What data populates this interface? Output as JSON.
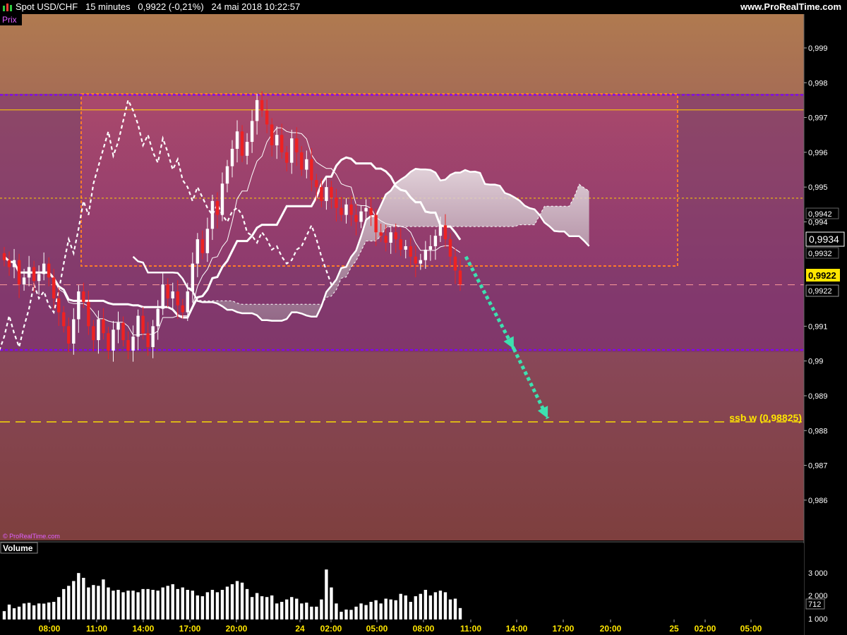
{
  "header": {
    "instrument": "Spot USD/CHF",
    "timeframe": "15 minutes",
    "quote": "0,9922 (-0,21%)",
    "datetime": "24 mai 2018 10:22:57",
    "site": "www.ProRealTime.com"
  },
  "price_panel": {
    "label": "Prix",
    "watermark": "© ProRealTime.com",
    "annotation": "ssb w (0,98825)",
    "badges": {
      "upper": "0,9942",
      "current_box": "0,9934",
      "lower": "0,9932",
      "last_yellow": "0,9922",
      "last_white": "0,9922"
    }
  },
  "volume_panel": {
    "label": "Volume",
    "axis_labels": [
      "3 000",
      "2 000",
      "1 000"
    ],
    "last_badge": "712"
  },
  "time_axis": {
    "labels": [
      "08:00",
      "11:00",
      "14:00",
      "17:00",
      "20:00",
      "24",
      "02:00",
      "05:00",
      "08:00",
      "11:00",
      "14:00",
      "17:00",
      "20:00",
      "25",
      "02:00",
      "05:00"
    ]
  },
  "colors": {
    "bull": "#ffffff",
    "bear": "#ee2222",
    "kijun": "#ffffff",
    "zone_border": "#ff7a2a",
    "level_line": "#7f00ff",
    "target_arrow": "#3de0b0",
    "accent_yellow": "#ffe600"
  },
  "chart_data": {
    "type": "candlestick",
    "y_axis_ticks": [
      "0,999",
      "0,998",
      "0,997",
      "0,996",
      "0,995",
      "0,994",
      "0,991",
      "0,99",
      "0,989",
      "0,988",
      "0,987",
      "0,986"
    ],
    "ylim": [
      0.9855,
      0.9998
    ],
    "levels": [
      {
        "name": "upper purple",
        "value": 0.99765
      },
      {
        "name": "lower purple",
        "value": 0.99032
      },
      {
        "name": "yellow solid",
        "value": 0.99722
      },
      {
        "name": "yellow dashed",
        "value": 0.99468
      },
      {
        "name": "ssb w",
        "value": 0.98825
      },
      {
        "name": "last price",
        "value": 0.99219
      }
    ],
    "zone": {
      "top": 0.99765,
      "bottom": 0.99283
    },
    "target_arrows": [
      {
        "from": 0.993,
        "to": 0.99035
      },
      {
        "from": 0.99035,
        "to": 0.98835
      }
    ],
    "price_path": [
      0.9929,
      0.9927,
      0.9929,
      0.9922,
      0.9924,
      0.9927,
      0.9923,
      0.9925,
      0.9928,
      0.9924,
      0.9918,
      0.9914,
      0.991,
      0.9905,
      0.9912,
      0.992,
      0.9917,
      0.991,
      0.9906,
      0.9912,
      0.9908,
      0.9903,
      0.9909,
      0.9911,
      0.9906,
      0.9903,
      0.9907,
      0.9913,
      0.9908,
      0.9904,
      0.991,
      0.9915,
      0.9922,
      0.9918,
      0.992,
      0.9916,
      0.9914,
      0.992,
      0.9928,
      0.9935,
      0.9931,
      0.9938,
      0.9946,
      0.9942,
      0.9951,
      0.9956,
      0.9961,
      0.9966,
      0.9959,
      0.9963,
      0.9969,
      0.9975,
      0.9972,
      0.9968,
      0.9962,
      0.9965,
      0.996,
      0.9957,
      0.9964,
      0.996,
      0.9955,
      0.9958,
      0.9952,
      0.995,
      0.9946,
      0.995,
      0.9947,
      0.9944,
      0.9942,
      0.9945,
      0.9942,
      0.994,
      0.9943,
      0.9944,
      0.9942,
      0.9937,
      0.9936,
      0.9934,
      0.9937,
      0.9935,
      0.9932,
      0.9933,
      0.993,
      0.9928,
      0.9929,
      0.9932,
      0.9933,
      0.9936,
      0.9939,
      0.9935,
      0.993,
      0.9926,
      0.9922
    ],
    "volumes": [
      520,
      930,
      700,
      800,
      1000,
      1040,
      880,
      1000,
      990,
      1060,
      1100,
      1400,
      1900,
      2100,
      2400,
      2900,
      2600,
      2000,
      2150,
      2100,
      2500,
      2000,
      1800,
      1850,
      1700,
      1800,
      1800,
      1700,
      1900,
      1900,
      1850,
      1800,
      2000,
      2100,
      2200,
      1900,
      2000,
      1850,
      1800,
      1500,
      1450,
      1700,
      1850,
      1700,
      1850,
      2050,
      2200,
      2400,
      2300,
      1900,
      1400,
      1650,
      1450,
      1400,
      1500,
      1000,
      1100,
      1250,
      1400,
      1300,
      1000,
      1050,
      800,
      800,
      1250,
      3120,
      2000,
      1000,
      480,
      620,
      600,
      800,
      1000,
      900,
      1100,
      1200,
      1000,
      1300,
      1250,
      1200,
      1600,
      1500,
      1100,
      1450,
      1600,
      1850,
      1500,
      1700,
      1800,
      1700,
      1250,
      1300,
      712
    ]
  }
}
